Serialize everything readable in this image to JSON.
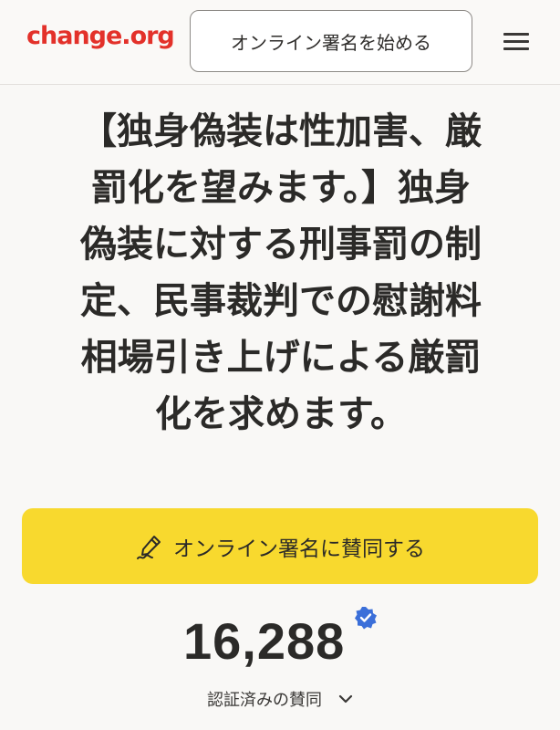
{
  "header": {
    "logo": "change.org",
    "start_button_label": "オンライン署名を始める",
    "logo_color": "#e3312a"
  },
  "petition": {
    "title_lines": [
      "【独身偽装は性加害、厳",
      "罰化を望みます。】独身",
      "偽装に対する刑事罰の制",
      "定、民事裁判での慰謝料",
      "相場引き上げによる厳罰",
      "化を求めます。"
    ]
  },
  "sign": {
    "button_label": "オンライン署名に賛同する",
    "icon": "pen-signature-icon",
    "button_color": "#f8d92e"
  },
  "supporters": {
    "count": "16,288",
    "verified_label": "認証済みの賛同",
    "verified_icon": "verified-badge-icon",
    "verified_color": "#3b6fd9"
  }
}
